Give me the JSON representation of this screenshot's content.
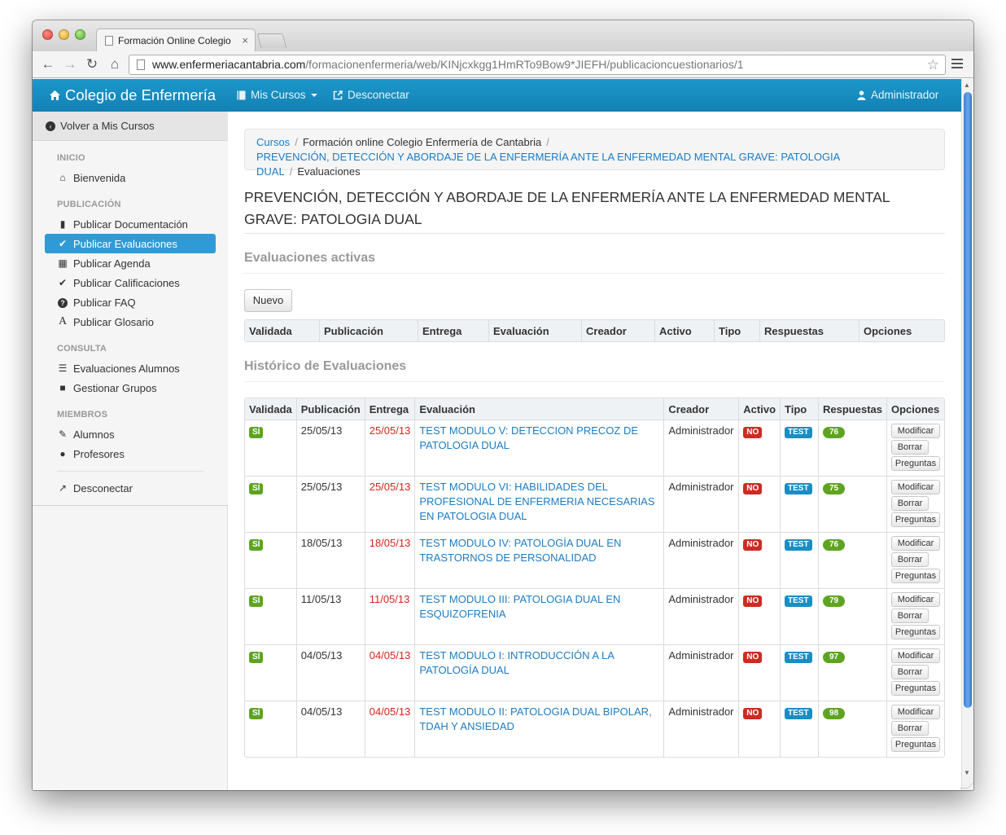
{
  "browser": {
    "tab_title": "Formación Online Colegio",
    "tab_close": "×",
    "url_host": "www.enfermeriacantabria.com",
    "url_path": "/formacionenfermeria/web/KINjcxkgg1HmRTo9Bow9*JIEFH/publicacioncuestionarios/1",
    "back_icon": "←",
    "forward_icon": "→",
    "reload_icon": "↻",
    "home_icon": "⌂",
    "star_icon": "☆"
  },
  "navbar": {
    "brand": "Colegio de Enfermería",
    "brand_icon": "home-icon",
    "mis_cursos": "Mis Cursos",
    "desconectar": "Desconectar",
    "user": "Administrador",
    "color": "#1a8dc2"
  },
  "sidebar": {
    "back": "Volver a Mis Cursos",
    "sections": {
      "inicio": "INICIO",
      "publicacion": "PUBLICACIÓN",
      "consulta": "CONSULTA",
      "miembros": "MIEMBROS"
    },
    "items": {
      "bienvenida": "Bienvenida",
      "publicar_documentacion": "Publicar Documentación",
      "publicar_evaluaciones": "Publicar Evaluaciones",
      "publicar_agenda": "Publicar Agenda",
      "publicar_calificaciones": "Publicar Calificaciones",
      "publicar_faq": "Publicar FAQ",
      "publicar_glosario": "Publicar Glosario",
      "evaluaciones_alumnos": "Evaluaciones Alumnos",
      "gestionar_grupos": "Gestionar Grupos",
      "alumnos": "Alumnos",
      "profesores": "Profesores",
      "desconectar": "Desconectar"
    },
    "active_color": "#2f9bd6"
  },
  "breadcrumb": {
    "cursos": "Cursos",
    "formacion": "Formación online Colegio Enfermería de Cantabria",
    "curso": "PREVENCIÓN, DETECCIÓN Y ABORDAJE DE LA ENFERMERÍA ANTE LA ENFERMEDAD MENTAL GRAVE: PATOLOGIA DUAL",
    "current": "Evaluaciones",
    "separator": "/"
  },
  "page_title": "PREVENCIÓN, DETECCIÓN Y ABORDAJE DE LA ENFERMERÍA ANTE LA ENFERMEDAD MENTAL GRAVE: PATOLOGIA DUAL",
  "activas": {
    "title": "Evaluaciones activas",
    "nuevo_button": "Nuevo",
    "headers": [
      "Validada",
      "Publicación",
      "Entrega",
      "Evaluación",
      "Creador",
      "Activo",
      "Tipo",
      "Respuestas",
      "Opciones"
    ]
  },
  "historico": {
    "title": "Histórico de Evaluaciones",
    "headers": [
      "Validada",
      "Publicación",
      "Entrega",
      "Evaluación",
      "Creador",
      "Activo",
      "Tipo",
      "Respuestas",
      "Opciones"
    ],
    "option_labels": {
      "modificar": "Modificar",
      "borrar": "Borrar",
      "preguntas": "Preguntas"
    },
    "rows": [
      {
        "validada": "SÍ",
        "publicacion": "25/05/13",
        "entrega": "25/05/13",
        "evaluacion": "TEST MODULO V: DETECCION PRECOZ DE PATOLOGIA DUAL",
        "creador": "Administrador",
        "activo": "NO",
        "tipo": "TEST",
        "respuestas": "76"
      },
      {
        "validada": "SÍ",
        "publicacion": "25/05/13",
        "entrega": "25/05/13",
        "evaluacion": "TEST MODULO VI: HABILIDADES DEL PROFESIONAL DE ENFERMERIA NECESARIAS EN PATOLOGIA DUAL",
        "creador": "Administrador",
        "activo": "NO",
        "tipo": "TEST",
        "respuestas": "75"
      },
      {
        "validada": "SÍ",
        "publicacion": "18/05/13",
        "entrega": "18/05/13",
        "evaluacion": "TEST MODULO IV: PATOLOGÍA DUAL EN TRASTORNOS DE PERSONALIDAD",
        "creador": "Administrador",
        "activo": "NO",
        "tipo": "TEST",
        "respuestas": "76"
      },
      {
        "validada": "SÍ",
        "publicacion": "11/05/13",
        "entrega": "11/05/13",
        "evaluacion": "TEST MODULO III: PATOLOGIA DUAL EN ESQUIZOFRENIA",
        "creador": "Administrador",
        "activo": "NO",
        "tipo": "TEST",
        "respuestas": "79"
      },
      {
        "validada": "SÍ",
        "publicacion": "04/05/13",
        "entrega": "04/05/13",
        "evaluacion": "TEST MODULO I: INTRODUCCIÓN A LA PATOLOGÍA DUAL",
        "creador": "Administrador",
        "activo": "NO",
        "tipo": "TEST",
        "respuestas": "97"
      },
      {
        "validada": "SÍ",
        "publicacion": "04/05/13",
        "entrega": "04/05/13",
        "evaluacion": "TEST MODULO II: PATOLOGIA DUAL BIPOLAR, TDAH Y ANSIEDAD",
        "creador": "Administrador",
        "activo": "NO",
        "tipo": "TEST",
        "respuestas": "98"
      }
    ]
  }
}
